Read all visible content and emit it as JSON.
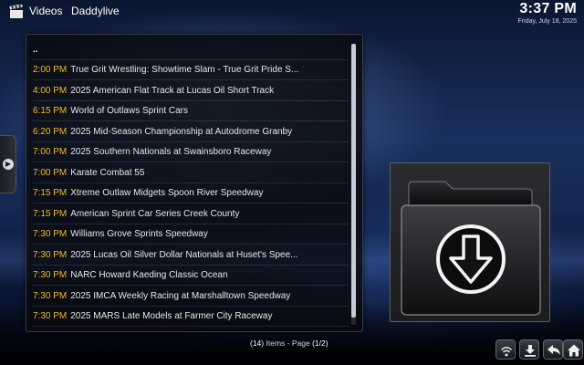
{
  "header": {
    "section": "Videos",
    "addon": "Daddylive",
    "time": "3:37 PM",
    "date": "Friday, July 18, 2025",
    "section_icon": "film-clapper-icon"
  },
  "list": {
    "parent_label": "..",
    "items": [
      {
        "time": "2:00 PM",
        "name": "True Grit Wrestling: Showtime Slam - True Grit Pride S..."
      },
      {
        "time": "4:00 PM",
        "name": "2025 American Flat Track at Lucas Oil Short Track"
      },
      {
        "time": "6:15 PM",
        "name": "World of Outlaws Sprint Cars"
      },
      {
        "time": "6:20 PM",
        "name": "2025 Mid-Season Championship at Autodrome Granby"
      },
      {
        "time": "7:00 PM",
        "name": "2025 Southern Nationals at Swainsboro Raceway"
      },
      {
        "time": "7:00 PM",
        "name": "Karate Combat 55"
      },
      {
        "time": "7:15 PM",
        "name": "Xtreme Outlaw Midgets Spoon River Speedway"
      },
      {
        "time": "7:15 PM",
        "name": "American Sprint Car Series Creek County"
      },
      {
        "time": "7:30 PM",
        "name": "Williams Grove Sprints Speedway"
      },
      {
        "time": "7:30 PM",
        "name": "2025 Lucas Oil Silver Dollar Nationals at Huset's Spee..."
      },
      {
        "time": "7:30 PM",
        "name": "NARC Howard Kaeding Classic Ocean"
      },
      {
        "time": "7:30 PM",
        "name": "2025 IMCA Weekly Racing at Marshalltown Speedway"
      },
      {
        "time": "7:30 PM",
        "name": "2025 MARS Late Models at Farmer City Raceway"
      }
    ]
  },
  "pager": {
    "count": "(14)",
    "items_label": "Items - Page",
    "page": "(1/2)"
  },
  "thumbnail": {
    "icon": "folder-download-icon"
  },
  "buttons": [
    {
      "name": "wifi-icon"
    },
    {
      "name": "download-icon"
    },
    {
      "name": "back-arrow-icon"
    },
    {
      "name": "home-icon"
    }
  ],
  "colors": {
    "time_accent": "#f2b930",
    "text": "#e8e8e8"
  }
}
